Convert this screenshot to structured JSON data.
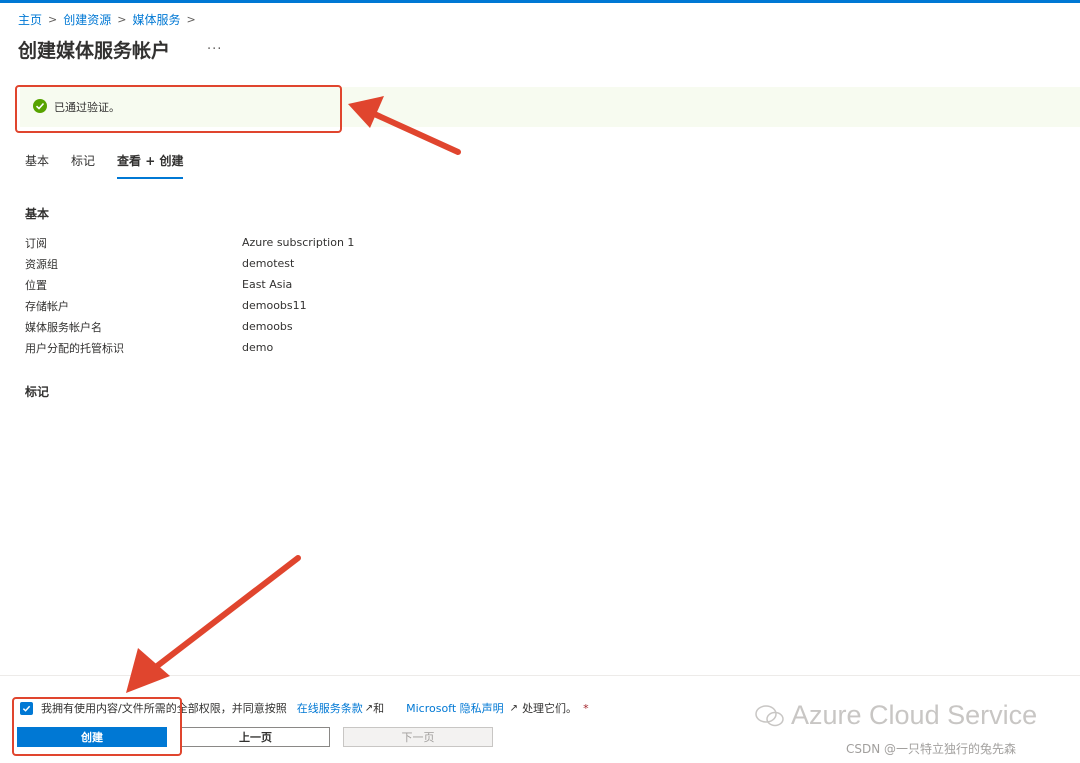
{
  "breadcrumb": {
    "items": [
      "主页",
      "创建资源",
      "媒体服务"
    ]
  },
  "page": {
    "title": "创建媒体服务帐户",
    "more": "..."
  },
  "banner": {
    "message": "已通过验证。"
  },
  "tabs": [
    {
      "label": "基本",
      "active": false
    },
    {
      "label": "标记",
      "active": false
    },
    {
      "label": "查看 + 创建",
      "active": true
    }
  ],
  "sections": {
    "basics_title": "基本",
    "tags_title": "标记"
  },
  "details": [
    {
      "key": "订阅",
      "value": "Azure subscription 1"
    },
    {
      "key": "资源组",
      "value": "demotest"
    },
    {
      "key": "位置",
      "value": "East Asia"
    },
    {
      "key": "存储帐户",
      "value": "demoobs11"
    },
    {
      "key": "媒体服务帐户名",
      "value": "demoobs"
    },
    {
      "key": "用户分配的托管标识",
      "value": "demo"
    }
  ],
  "footer": {
    "consent_text": "我拥有使用内容/文件所需的全部权限，并同意按照",
    "terms_link": "在线服务条款",
    "and": "和",
    "privacy_link": "Microsoft 隐私声明",
    "suffix": "处理它们。",
    "required_mark": "*",
    "create_label": "创建",
    "prev_label": "上一页",
    "next_label": "下一页"
  },
  "watermark": {
    "brand": "Azure Cloud Service",
    "credit": "CSDN @一只特立独行的兔先森"
  },
  "colors": {
    "accent": "#0078d4",
    "success": "#57a300",
    "annotation": "#e0452e"
  }
}
